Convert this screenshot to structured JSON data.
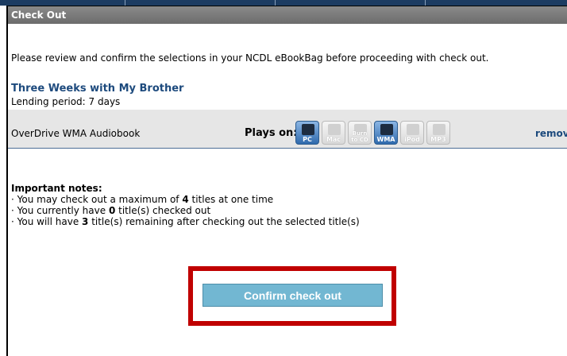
{
  "header": {
    "title": "Check Out"
  },
  "intro_text": "Please review and confirm the selections in your NCDL eBookBag before proceeding with check out.",
  "item": {
    "title": "Three Weeks with My Brother",
    "lending_period": "Lending period: 7 days",
    "format": "OverDrive WMA Audiobook",
    "plays_on_label": "Plays on:",
    "devices": [
      {
        "icon": "pc-icon",
        "caption": "PC",
        "enabled": true
      },
      {
        "icon": "mac-icon",
        "caption": "Mac",
        "enabled": false
      },
      {
        "icon": "burn-cd-icon",
        "caption": "Burn to CD",
        "enabled": false
      },
      {
        "icon": "wma-icon",
        "caption": "WMA",
        "enabled": true
      },
      {
        "icon": "ipod-icon",
        "caption": "iPod",
        "enabled": false
      },
      {
        "icon": "mp3-icon",
        "caption": "MP3",
        "enabled": false
      }
    ],
    "remove_label": "remove"
  },
  "notes": {
    "title": "Important notes:",
    "lines": [
      {
        "before": "· You may check out a maximum of ",
        "value": "4",
        "after": " titles at one time"
      },
      {
        "before": "· You currently have ",
        "value": "0",
        "after": " title(s) checked out"
      },
      {
        "before": "· You will have ",
        "value": "3",
        "after": " title(s) remaining after checking out the selected title(s)"
      }
    ]
  },
  "confirm_button": {
    "label": "Confirm check out"
  },
  "colors": {
    "header_bg": "#7a7a7a",
    "link": "#1d4a7d",
    "button_bg": "#72b7d2",
    "highlight": "#c00000",
    "top_strip": "#1c3c62"
  }
}
